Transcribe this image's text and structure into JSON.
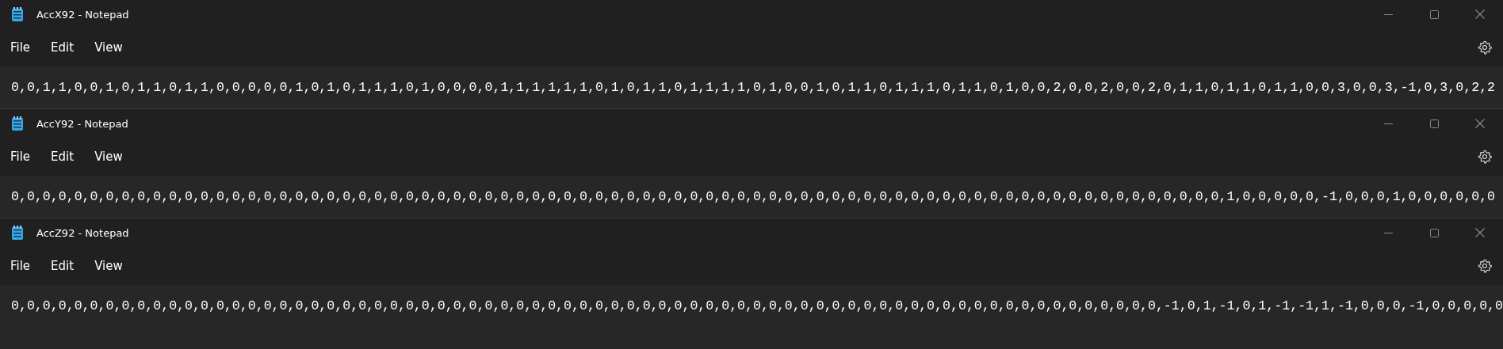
{
  "windows": [
    {
      "title": "AccX92 - Notepad",
      "menu": [
        "File",
        "Edit",
        "View"
      ],
      "text": "0,0,1,1,0,0,1,0,1,1,0,1,1,0,0,0,0,0,1,0,1,0,1,1,1,0,1,0,0,0,0,1,1,1,1,1,1,0,1,0,1,1,0,1,1,1,1,0,1,0,0,1,0,1,1,0,1,1,1,0,1,1,0,1,0,0,2,0,0,2,0,0,2,0,1,1,0,1,1,0,1,1,0,0,3,0,0,3,-1,0,3,0,2,2"
    },
    {
      "title": "AccY92 - Notepad",
      "menu": [
        "File",
        "Edit",
        "View"
      ],
      "text": "0,0,0,0,0,0,0,0,0,0,0,0,0,0,0,0,0,0,0,0,0,0,0,0,0,0,0,0,0,0,0,0,0,0,0,0,0,0,0,0,0,0,0,0,0,0,0,0,0,0,0,0,0,0,0,0,0,0,0,0,0,0,0,0,0,0,0,0,0,0,0,0,0,0,0,0,0,1,0,0,0,0,0,-1,0,0,0,1,0,0,0,0,0,0"
    },
    {
      "title": "AccZ92 - Notepad",
      "menu": [
        "File",
        "Edit",
        "View"
      ],
      "text": "0,0,0,0,0,0,0,0,0,0,0,0,0,0,0,0,0,0,0,0,0,0,0,0,0,0,0,0,0,0,0,0,0,0,0,0,0,0,0,0,0,0,0,0,0,0,0,0,0,0,0,0,0,0,0,0,0,0,0,0,0,0,0,0,0,0,0,0,0,0,0,0,0,-1,0,1,-1,0,1,-1,-1,1,-1,0,0,0,-1,0,0,0,0,0"
    }
  ]
}
